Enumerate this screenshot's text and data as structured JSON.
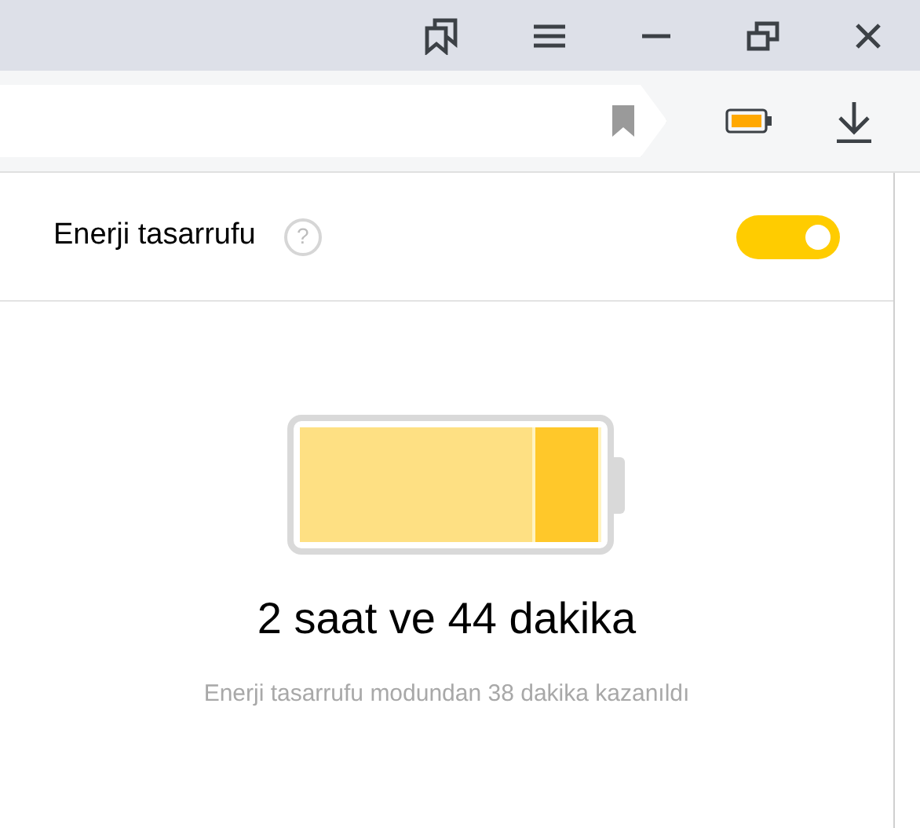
{
  "popup": {
    "title": "Enerji tasarrufu",
    "help": "?",
    "toggle": {
      "on": true
    },
    "battery": {
      "level": 0.79
    },
    "remaining": "2 saat ve 44 dakika",
    "note": "Enerji tasarrufu modundan 38 dakika kazanıldı"
  }
}
